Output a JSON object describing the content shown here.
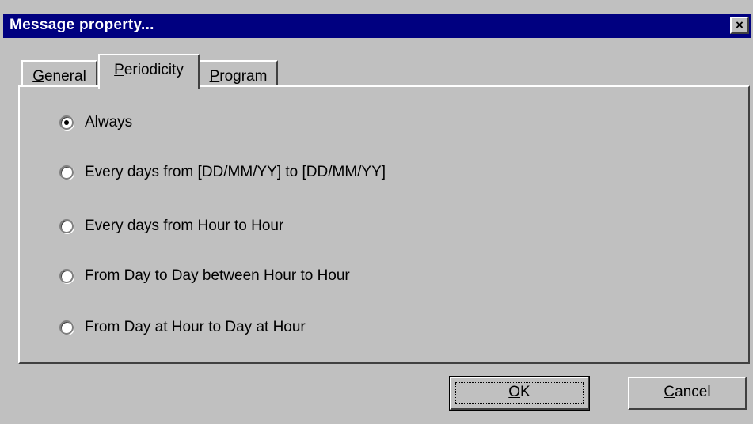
{
  "window": {
    "title": "Message property..."
  },
  "tabs": [
    {
      "label_pre": "",
      "label_accel": "G",
      "label_post": "eneral"
    },
    {
      "label_pre": "",
      "label_accel": "P",
      "label_post": "eriodicity"
    },
    {
      "label_pre": "",
      "label_accel": "P",
      "label_post": "rogram"
    }
  ],
  "active_tab": "Periodicity",
  "periodicity": {
    "options": [
      {
        "label": "Always",
        "checked": true
      },
      {
        "label": "Every days from [DD/MM/YY] to [DD/MM/YY]",
        "checked": false
      },
      {
        "label": "Every days from Hour to Hour",
        "checked": false
      },
      {
        "label": "From Day to Day between Hour to Hour",
        "checked": false
      },
      {
        "label": "From Day at Hour to Day at Hour",
        "checked": false
      }
    ]
  },
  "buttons": {
    "ok_accel": "O",
    "ok_rest": "K",
    "cancel_accel": "C",
    "cancel_rest": "ancel"
  },
  "icons": {
    "close": "close-x-icon"
  }
}
